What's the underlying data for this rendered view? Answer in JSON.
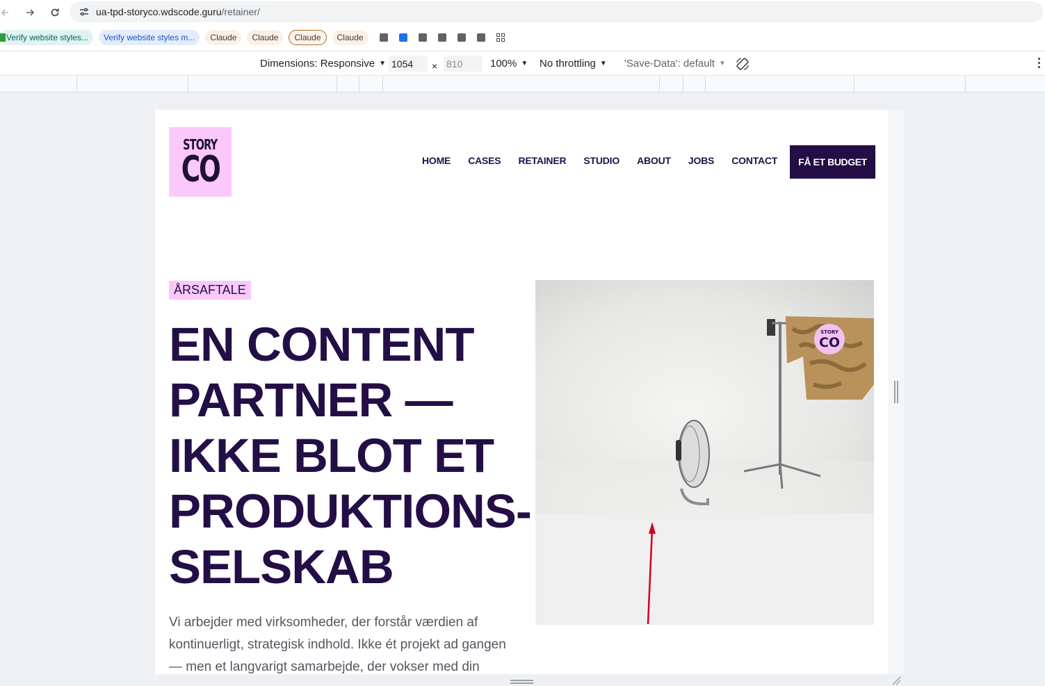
{
  "browser": {
    "url_host": "ua-tpd-storyco.wdscode.guru",
    "url_path": "/retainer/"
  },
  "bookmarks": [
    {
      "label": "Verify website styles..."
    },
    {
      "label": "Verify website styles m..."
    },
    {
      "label": "Claude"
    },
    {
      "label": "Claude"
    },
    {
      "label": "Claude"
    },
    {
      "label": "Claude"
    }
  ],
  "devtools": {
    "dimensions_label": "Dimensions: Responsive",
    "width": "1054",
    "times": "×",
    "height_placeholder": "810",
    "zoom": "100%",
    "throttling": "No throttling",
    "save_data": "'Save-Data': default"
  },
  "site": {
    "logo_line1": "STORY",
    "logo_line2": "CO",
    "nav": [
      "HOME",
      "CASES",
      "RETAINER",
      "STUDIO",
      "ABOUT",
      "JOBS",
      "CONTACT"
    ],
    "cta": "FÅ ET BUDGET",
    "tag": "ÅRSAFTALE",
    "headline": [
      "EN CONTENT",
      "PARTNER —",
      "IKKE BLOT ET",
      "PRODUKTIONS-",
      "SELSKAB"
    ],
    "body": "Vi arbejder med virksomheder, der forstår værdien af kontinuerligt, strategisk indhold. Ikke ét projekt ad gangen — men et langvarigt samarbejde, der vokser med din",
    "hero_badge_line1": "STORY",
    "hero_badge_line2": "CO"
  },
  "colors": {
    "brand_dark": "#230e46",
    "brand_pink": "#fbc8fb",
    "annotation_arrow": "#d0021b"
  }
}
